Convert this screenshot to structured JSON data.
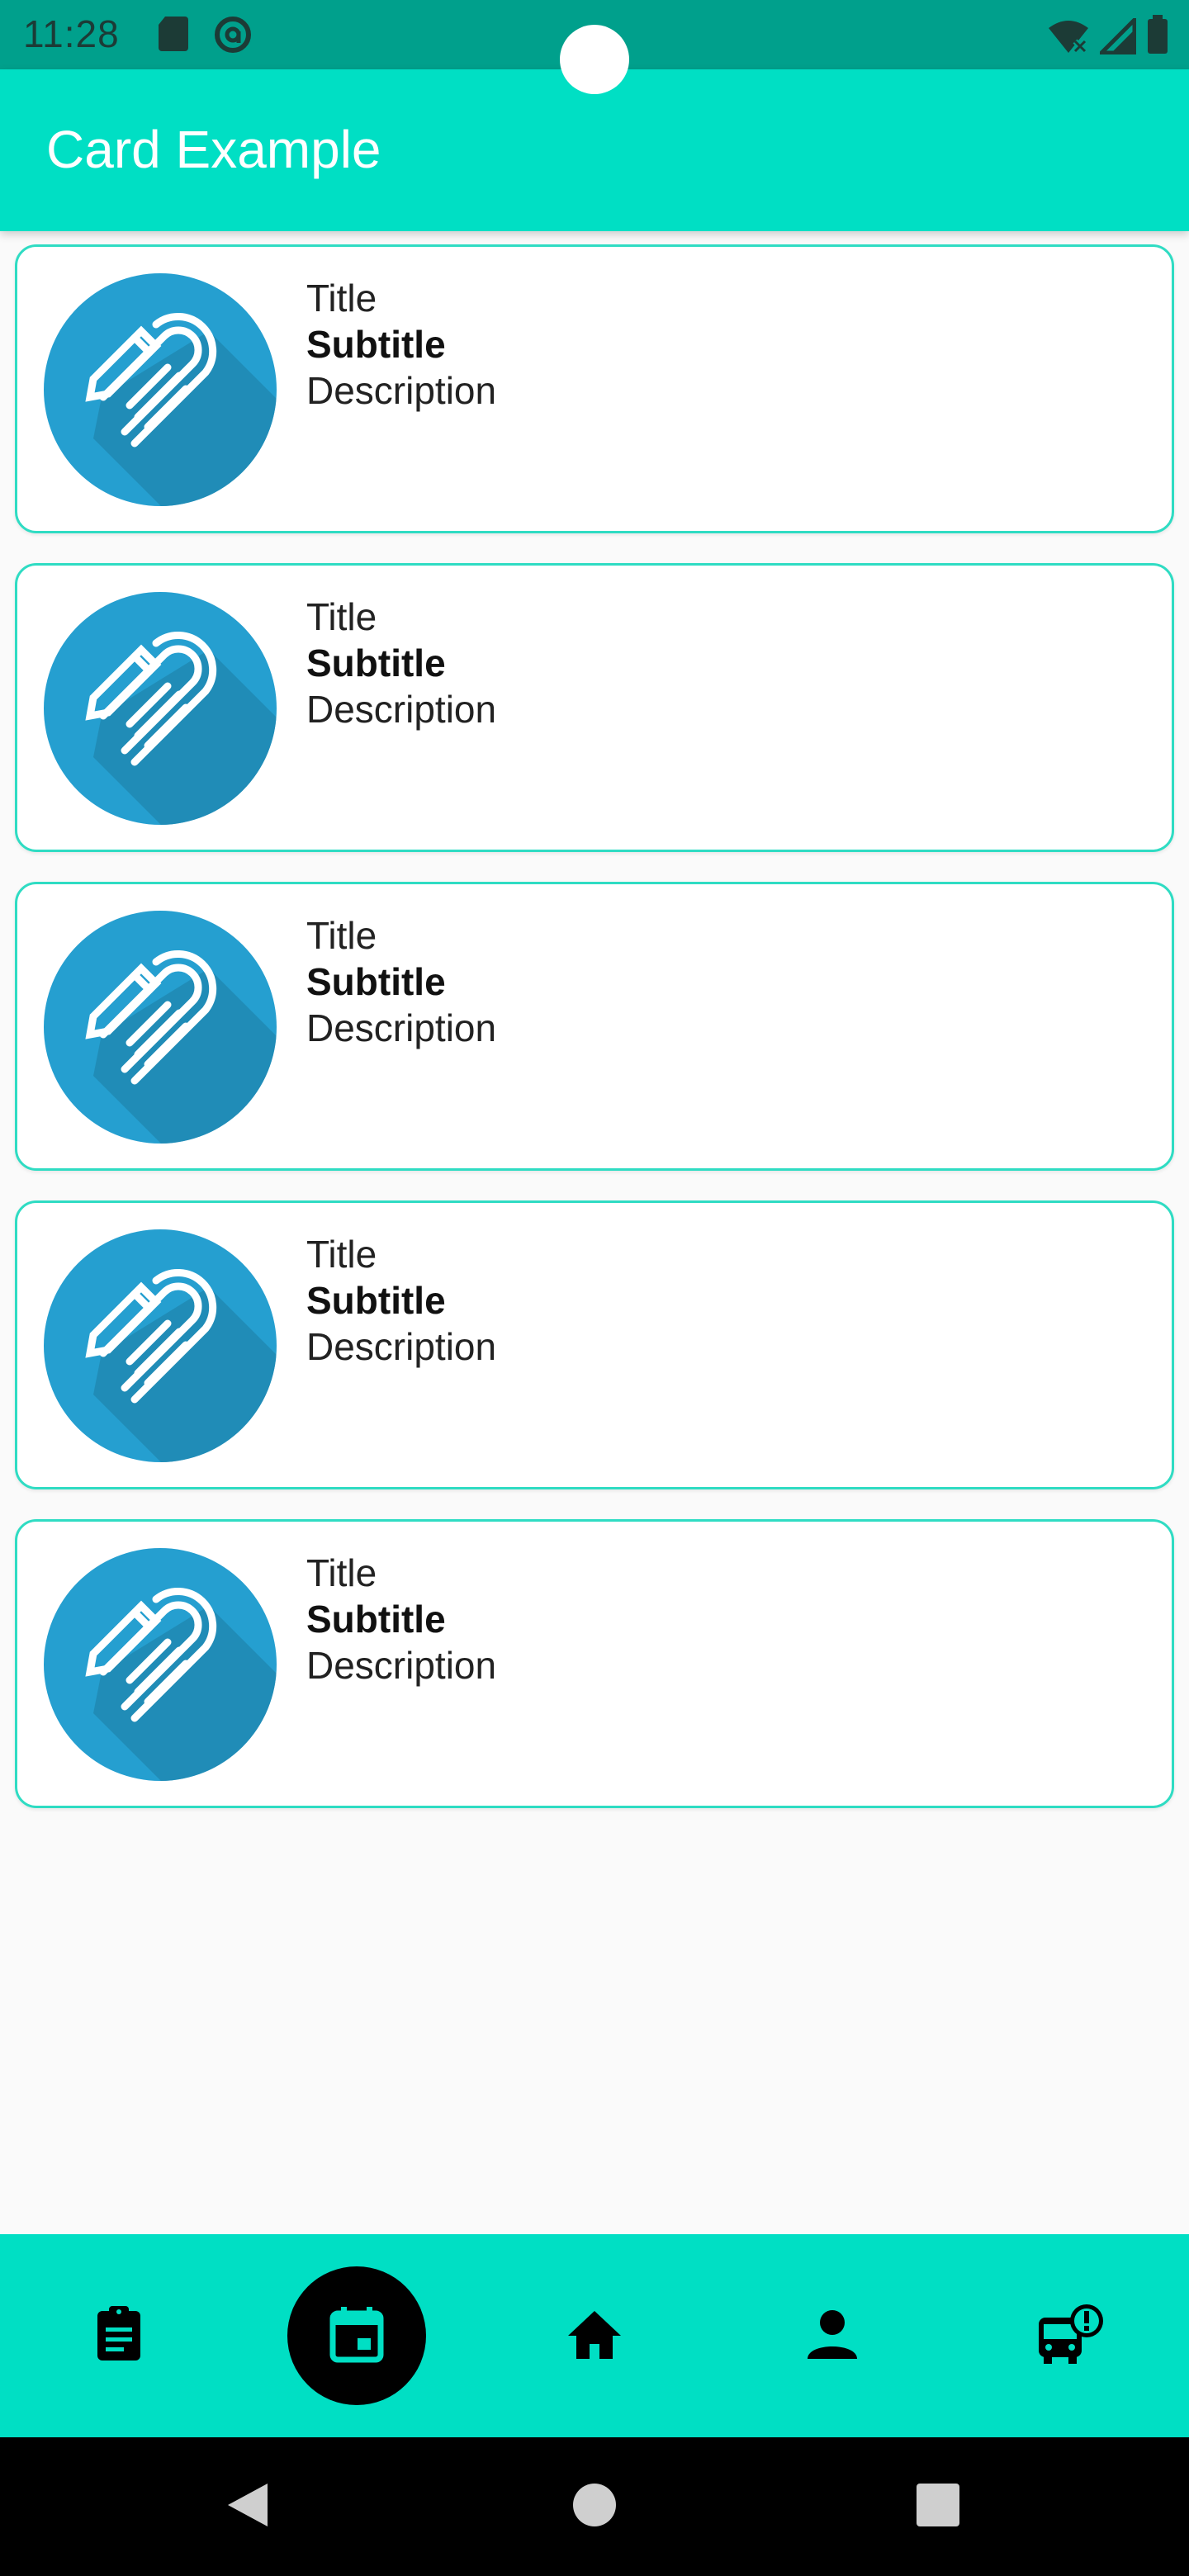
{
  "status_bar": {
    "time": "11:28",
    "left_icons": [
      "sd-card-icon",
      "at-sign-icon"
    ],
    "right_icons": [
      "wifi-off-icon",
      "cell-signal-icon",
      "battery-icon"
    ]
  },
  "app_bar": {
    "title": "Card Example",
    "color": "#00dfc4"
  },
  "cards": [
    {
      "title": "Title",
      "subtitle": "Subtitle",
      "description": "Description",
      "icon": "notes-pencil-icon"
    },
    {
      "title": "Title",
      "subtitle": "Subtitle",
      "description": "Description",
      "icon": "notes-pencil-icon"
    },
    {
      "title": "Title",
      "subtitle": "Subtitle",
      "description": "Description",
      "icon": "notes-pencil-icon"
    },
    {
      "title": "Title",
      "subtitle": "Subtitle",
      "description": "Description",
      "icon": "notes-pencil-icon"
    },
    {
      "title": "Title",
      "subtitle": "Subtitle",
      "description": "Description",
      "icon": "notes-pencil-icon"
    }
  ],
  "bottom_nav": {
    "items": [
      {
        "icon": "clipboard-icon",
        "active": false
      },
      {
        "icon": "calendar-icon",
        "active": true
      },
      {
        "icon": "home-icon",
        "active": false
      },
      {
        "icon": "person-icon",
        "active": false
      },
      {
        "icon": "bus-alert-icon",
        "active": false
      }
    ],
    "accent": "#00dfc4"
  },
  "system_nav": {
    "buttons": [
      "back-icon",
      "home-circle-icon",
      "recents-square-icon"
    ]
  }
}
